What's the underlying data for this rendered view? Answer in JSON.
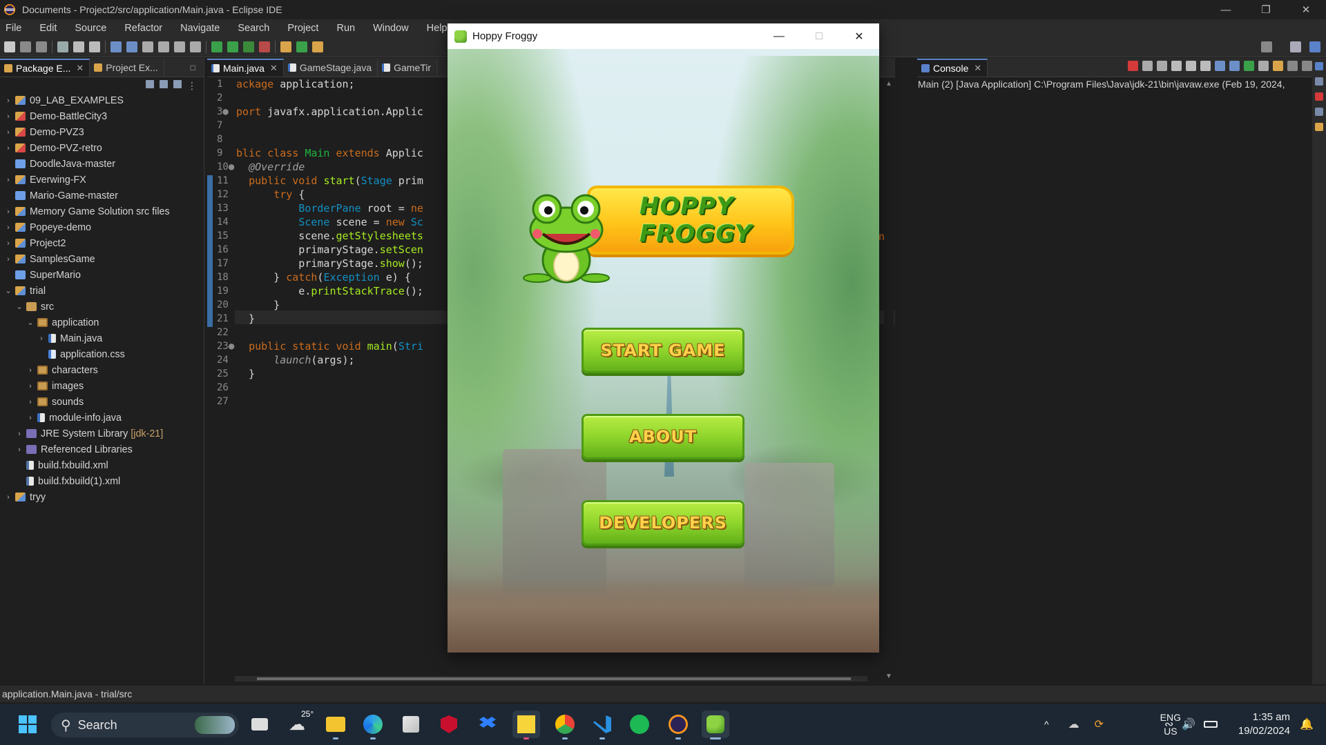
{
  "eclipse": {
    "title": "Documents - Project2/src/application/Main.java - Eclipse IDE",
    "menu": [
      "File",
      "Edit",
      "Source",
      "Refactor",
      "Navigate",
      "Search",
      "Project",
      "Run",
      "Window",
      "Help"
    ],
    "status_text": "application.Main.java - trial/src"
  },
  "package_explorer": {
    "tabs": [
      {
        "label": "Package E..."
      },
      {
        "label": "Project Ex..."
      }
    ],
    "tree": [
      {
        "label": "09_LAB_EXAMPLES",
        "depth": 0,
        "icon": "project-icon",
        "twisty": ">"
      },
      {
        "label": "Demo-BattleCity3",
        "depth": 0,
        "icon": "project-error-icon",
        "twisty": ">"
      },
      {
        "label": "Demo-PVZ3",
        "depth": 0,
        "icon": "project-error-icon",
        "twisty": ">"
      },
      {
        "label": "Demo-PVZ-retro",
        "depth": 0,
        "icon": "project-error-icon",
        "twisty": ">"
      },
      {
        "label": "DoodleJava-master",
        "depth": 0,
        "icon": "folder-icon",
        "twisty": ""
      },
      {
        "label": "Everwing-FX",
        "depth": 0,
        "icon": "project-icon",
        "twisty": ">"
      },
      {
        "label": "Mario-Game-master",
        "depth": 0,
        "icon": "folder-icon",
        "twisty": ""
      },
      {
        "label": "Memory Game Solution src files",
        "depth": 0,
        "icon": "project-icon",
        "twisty": ">"
      },
      {
        "label": "Popeye-demo",
        "depth": 0,
        "icon": "project-icon",
        "twisty": ">"
      },
      {
        "label": "Project2",
        "depth": 0,
        "icon": "project-icon",
        "twisty": ">"
      },
      {
        "label": "SamplesGame",
        "depth": 0,
        "icon": "project-icon",
        "twisty": ">"
      },
      {
        "label": "SuperMario",
        "depth": 0,
        "icon": "folder-icon",
        "twisty": ""
      },
      {
        "label": "trial",
        "depth": 0,
        "icon": "project-icon",
        "twisty": "v"
      },
      {
        "label": "src",
        "depth": 1,
        "icon": "source-folder-icon",
        "twisty": "v"
      },
      {
        "label": "application",
        "depth": 2,
        "icon": "package-icon",
        "twisty": "v"
      },
      {
        "label": "Main.java",
        "depth": 3,
        "icon": "java-file-icon",
        "twisty": ">"
      },
      {
        "label": "application.css",
        "depth": 3,
        "icon": "css-file-icon",
        "twisty": ""
      },
      {
        "label": "characters",
        "depth": 2,
        "icon": "package-icon",
        "twisty": ">"
      },
      {
        "label": "images",
        "depth": 2,
        "icon": "package-icon",
        "twisty": ">"
      },
      {
        "label": "sounds",
        "depth": 2,
        "icon": "package-icon",
        "twisty": ">"
      },
      {
        "label": "module-info.java",
        "depth": 2,
        "icon": "java-file-icon",
        "twisty": ">"
      },
      {
        "label": "JRE System Library",
        "suffix": "[jdk-21]",
        "depth": 1,
        "icon": "library-icon",
        "twisty": ">"
      },
      {
        "label": "Referenced Libraries",
        "depth": 1,
        "icon": "library-icon",
        "twisty": ">"
      },
      {
        "label": "build.fxbuild.xml",
        "depth": 1,
        "icon": "xml-file-icon",
        "twisty": ""
      },
      {
        "label": "build.fxbuild(1).xml",
        "depth": 1,
        "icon": "xml-file-icon",
        "twisty": ""
      },
      {
        "label": "tryy",
        "depth": 0,
        "icon": "project-icon",
        "twisty": ">"
      }
    ]
  },
  "editor": {
    "tabs": [
      {
        "label": "Main.java",
        "active": true
      },
      {
        "label": "GameStage.java",
        "active": false
      },
      {
        "label": "GameTir",
        "active": false
      }
    ],
    "lines": [
      {
        "n": "1",
        "html": "<span class='kw'>ackage</span> application;"
      },
      {
        "n": "2",
        "html": ""
      },
      {
        "n": "3●",
        "html": "<span class='kw'>port</span> javafx.application.Applic"
      },
      {
        "n": "7",
        "html": ""
      },
      {
        "n": "8",
        "html": ""
      },
      {
        "n": "9",
        "html": "<span class='kw'>blic class</span> <span class='cl'>Main</span> <span class='kw'>extends</span> Applic"
      },
      {
        "n": "10●",
        "html": "  <span class='an'>@Override</span>"
      },
      {
        "n": "11",
        "html": "  <span class='kw'>public void</span> <span class='mt'>start</span>(<span class='ty'>Stage</span> prim"
      },
      {
        "n": "12",
        "html": "      <span class='kw'>try</span> {"
      },
      {
        "n": "13",
        "html": "          <span class='ty'>BorderPane</span> root = <span class='kw'>ne</span>"
      },
      {
        "n": "14",
        "html": "          <span class='ty'>Scene</span> scene = <span class='kw'>new</span> <span class='ty'>Sc</span>"
      },
      {
        "n": "15",
        "html": "          scene.<span class='mt'>getStylesheets</span>"
      },
      {
        "n": "16",
        "html": "          primaryStage.<span class='mt'>setScen</span>"
      },
      {
        "n": "17",
        "html": "          primaryStage.<span class='mt'>show</span>();"
      },
      {
        "n": "18",
        "html": "      } <span class='kw'>catch</span>(<span class='ty'>Exception</span> e) {"
      },
      {
        "n": "19",
        "html": "          e.<span class='mt'>printStackTrace</span>();"
      },
      {
        "n": "20",
        "html": "      }"
      },
      {
        "n": "21",
        "html": "  }"
      },
      {
        "n": "22",
        "html": ""
      },
      {
        "n": "23●",
        "html": "  <span class='kw'>public static void</span> <span class='mt'>main</span>(<span class='ty'>Stri</span>"
      },
      {
        "n": "24",
        "html": "      <span class='an'>launch</span>(args);"
      },
      {
        "n": "25",
        "html": "  }"
      },
      {
        "n": "26",
        "html": ""
      },
      {
        "n": "27",
        "html": ""
      }
    ],
    "peek_right": "n("
  },
  "console": {
    "tab_label": "Console",
    "line": "Main (2) [Java Application] C:\\Program Files\\Java\\jdk-21\\bin\\javaw.exe  (Feb 19, 2024,"
  },
  "game": {
    "window_title": "Hoppy Froggy",
    "logo_text": "HOPPY FROGGY",
    "buttons": [
      "START GAME",
      "ABOUT",
      "DEVELOPERS"
    ]
  },
  "taskbar": {
    "search_label": "Search",
    "weather_temp": "25°",
    "lang_top": "ENG",
    "lang_bottom": "US",
    "time": "1:35 am",
    "date": "19/02/2024"
  },
  "colors": {
    "accent": "#5a82c8",
    "game_button": "#8fd52c",
    "logo_banner": "#ffc51a"
  }
}
